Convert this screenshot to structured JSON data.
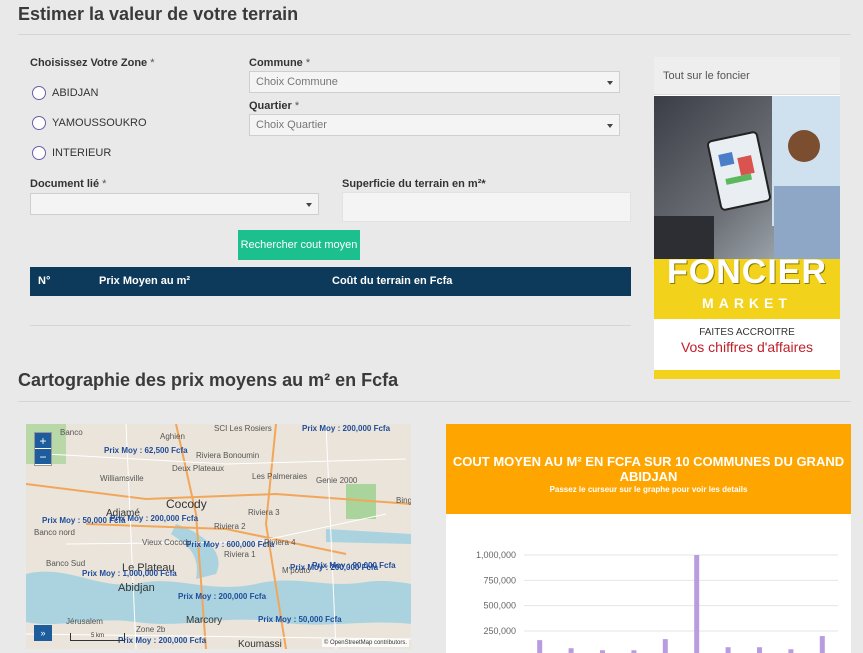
{
  "titles": {
    "estimate": "Estimer la valeur de votre terrain",
    "map_section": "Cartographie des prix moyens au m² en Fcfa"
  },
  "form": {
    "zone_label": "Choisissez Votre Zone",
    "required": "*",
    "zones": [
      "ABIDJAN",
      "YAMOUSSOUKRO",
      "INTERIEUR"
    ],
    "commune_label": "Commune",
    "commune_placeholder": "Choix Commune",
    "quartier_label": "Quartier",
    "quartier_placeholder": "Choix Quartier",
    "document_label": "Document lié",
    "document_value": "",
    "superficie_label": "Superficie du terrain en m²*",
    "search_button": "Rechercher cout moyen"
  },
  "table": {
    "headers": [
      "N°",
      "Prix Moyen au m²",
      "Coût du terrain en Fcfa"
    ]
  },
  "sidebar": {
    "header": "Tout sur le foncier",
    "ad_title": "FONCIER",
    "ad_subtitle": "MARKET",
    "ad_line1": "FAITES ACCROITRE",
    "ad_line2": "Vos chiffres d'affaires"
  },
  "map": {
    "zoom_in": "+",
    "zoom_out": "−",
    "places": [
      "Banco",
      "Aghien",
      "SCI Les Rosiers",
      "Riviera Bonoumin",
      "Deux Plateaux",
      "Williamsville",
      "Les Palmeraies",
      "Genie 2000",
      "Cocody",
      "Adjamé",
      "Riviera 3",
      "Riviera 2",
      "Banco nord",
      "Vieux Cocody",
      "Riviera 4",
      "Riviera 1",
      "Bing",
      "Banco Sud",
      "Le Plateau",
      "M'pouto",
      "Abidjan",
      "Jérusalem",
      "Zone 2b",
      "Marcory",
      "Koumassi"
    ],
    "prix_labels": [
      "Prix Moy : 62,500 Fcfa",
      "Prix Moy : 200,000 Fcfa",
      "Prix Moy : 50,000 Fcfa",
      "Prix Moy : 200,000 Fcfa",
      "Prix Moy : 600,000 Fcfa",
      "Prix Moy : 1,000,000 Fcfa",
      "Prix Moy : 90,000 Fcfa",
      "Prix Moy : 200,000 Fcfa",
      "Prix Moy : 200,000 Fcfa",
      "Prix Moy : 50,000 Fcfa",
      "Prix Moy : 200,000 Fcfa"
    ],
    "scale": "5 km",
    "attribution": "© OpenStreetMap contributors."
  },
  "colors": {
    "bar": "#b89cdf",
    "header": "#ffa500",
    "table": "#0d3a5a",
    "button": "#1cc08e"
  },
  "chart_data": {
    "type": "bar",
    "title": "COUT MOYEN AU M² EN FCFA SUR 10 COMMUNES DU GRAND ABIDJAN",
    "subtitle": "Passez le curseur sur le graphe pour voir les details",
    "ylim": [
      0,
      1150000
    ],
    "yticks": [
      250000,
      500000,
      750000,
      1000000
    ],
    "ytick_labels": [
      "250,000",
      "500,000",
      "750,000",
      "1,000,000"
    ],
    "values": [
      160000,
      80000,
      60000,
      60000,
      170000,
      1000000,
      90000,
      90000,
      70000,
      200000
    ]
  }
}
